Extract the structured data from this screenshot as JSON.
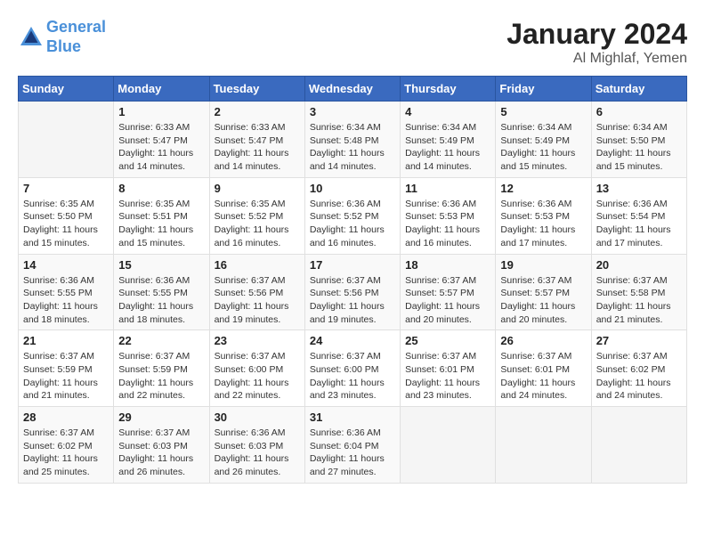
{
  "header": {
    "logo_line1": "General",
    "logo_line2": "Blue",
    "main_title": "January 2024",
    "subtitle": "Al Mighlaf, Yemen"
  },
  "days_of_week": [
    "Sunday",
    "Monday",
    "Tuesday",
    "Wednesday",
    "Thursday",
    "Friday",
    "Saturday"
  ],
  "weeks": [
    [
      {
        "day": "",
        "sunrise": "",
        "sunset": "",
        "daylight": "",
        "empty": true
      },
      {
        "day": "1",
        "sunrise": "Sunrise: 6:33 AM",
        "sunset": "Sunset: 5:47 PM",
        "daylight": "Daylight: 11 hours and 14 minutes."
      },
      {
        "day": "2",
        "sunrise": "Sunrise: 6:33 AM",
        "sunset": "Sunset: 5:47 PM",
        "daylight": "Daylight: 11 hours and 14 minutes."
      },
      {
        "day": "3",
        "sunrise": "Sunrise: 6:34 AM",
        "sunset": "Sunset: 5:48 PM",
        "daylight": "Daylight: 11 hours and 14 minutes."
      },
      {
        "day": "4",
        "sunrise": "Sunrise: 6:34 AM",
        "sunset": "Sunset: 5:49 PM",
        "daylight": "Daylight: 11 hours and 14 minutes."
      },
      {
        "day": "5",
        "sunrise": "Sunrise: 6:34 AM",
        "sunset": "Sunset: 5:49 PM",
        "daylight": "Daylight: 11 hours and 15 minutes."
      },
      {
        "day": "6",
        "sunrise": "Sunrise: 6:34 AM",
        "sunset": "Sunset: 5:50 PM",
        "daylight": "Daylight: 11 hours and 15 minutes."
      }
    ],
    [
      {
        "day": "7",
        "sunrise": "Sunrise: 6:35 AM",
        "sunset": "Sunset: 5:50 PM",
        "daylight": "Daylight: 11 hours and 15 minutes."
      },
      {
        "day": "8",
        "sunrise": "Sunrise: 6:35 AM",
        "sunset": "Sunset: 5:51 PM",
        "daylight": "Daylight: 11 hours and 15 minutes."
      },
      {
        "day": "9",
        "sunrise": "Sunrise: 6:35 AM",
        "sunset": "Sunset: 5:52 PM",
        "daylight": "Daylight: 11 hours and 16 minutes."
      },
      {
        "day": "10",
        "sunrise": "Sunrise: 6:36 AM",
        "sunset": "Sunset: 5:52 PM",
        "daylight": "Daylight: 11 hours and 16 minutes."
      },
      {
        "day": "11",
        "sunrise": "Sunrise: 6:36 AM",
        "sunset": "Sunset: 5:53 PM",
        "daylight": "Daylight: 11 hours and 16 minutes."
      },
      {
        "day": "12",
        "sunrise": "Sunrise: 6:36 AM",
        "sunset": "Sunset: 5:53 PM",
        "daylight": "Daylight: 11 hours and 17 minutes."
      },
      {
        "day": "13",
        "sunrise": "Sunrise: 6:36 AM",
        "sunset": "Sunset: 5:54 PM",
        "daylight": "Daylight: 11 hours and 17 minutes."
      }
    ],
    [
      {
        "day": "14",
        "sunrise": "Sunrise: 6:36 AM",
        "sunset": "Sunset: 5:55 PM",
        "daylight": "Daylight: 11 hours and 18 minutes."
      },
      {
        "day": "15",
        "sunrise": "Sunrise: 6:36 AM",
        "sunset": "Sunset: 5:55 PM",
        "daylight": "Daylight: 11 hours and 18 minutes."
      },
      {
        "day": "16",
        "sunrise": "Sunrise: 6:37 AM",
        "sunset": "Sunset: 5:56 PM",
        "daylight": "Daylight: 11 hours and 19 minutes."
      },
      {
        "day": "17",
        "sunrise": "Sunrise: 6:37 AM",
        "sunset": "Sunset: 5:56 PM",
        "daylight": "Daylight: 11 hours and 19 minutes."
      },
      {
        "day": "18",
        "sunrise": "Sunrise: 6:37 AM",
        "sunset": "Sunset: 5:57 PM",
        "daylight": "Daylight: 11 hours and 20 minutes."
      },
      {
        "day": "19",
        "sunrise": "Sunrise: 6:37 AM",
        "sunset": "Sunset: 5:57 PM",
        "daylight": "Daylight: 11 hours and 20 minutes."
      },
      {
        "day": "20",
        "sunrise": "Sunrise: 6:37 AM",
        "sunset": "Sunset: 5:58 PM",
        "daylight": "Daylight: 11 hours and 21 minutes."
      }
    ],
    [
      {
        "day": "21",
        "sunrise": "Sunrise: 6:37 AM",
        "sunset": "Sunset: 5:59 PM",
        "daylight": "Daylight: 11 hours and 21 minutes."
      },
      {
        "day": "22",
        "sunrise": "Sunrise: 6:37 AM",
        "sunset": "Sunset: 5:59 PM",
        "daylight": "Daylight: 11 hours and 22 minutes."
      },
      {
        "day": "23",
        "sunrise": "Sunrise: 6:37 AM",
        "sunset": "Sunset: 6:00 PM",
        "daylight": "Daylight: 11 hours and 22 minutes."
      },
      {
        "day": "24",
        "sunrise": "Sunrise: 6:37 AM",
        "sunset": "Sunset: 6:00 PM",
        "daylight": "Daylight: 11 hours and 23 minutes."
      },
      {
        "day": "25",
        "sunrise": "Sunrise: 6:37 AM",
        "sunset": "Sunset: 6:01 PM",
        "daylight": "Daylight: 11 hours and 23 minutes."
      },
      {
        "day": "26",
        "sunrise": "Sunrise: 6:37 AM",
        "sunset": "Sunset: 6:01 PM",
        "daylight": "Daylight: 11 hours and 24 minutes."
      },
      {
        "day": "27",
        "sunrise": "Sunrise: 6:37 AM",
        "sunset": "Sunset: 6:02 PM",
        "daylight": "Daylight: 11 hours and 24 minutes."
      }
    ],
    [
      {
        "day": "28",
        "sunrise": "Sunrise: 6:37 AM",
        "sunset": "Sunset: 6:02 PM",
        "daylight": "Daylight: 11 hours and 25 minutes."
      },
      {
        "day": "29",
        "sunrise": "Sunrise: 6:37 AM",
        "sunset": "Sunset: 6:03 PM",
        "daylight": "Daylight: 11 hours and 26 minutes."
      },
      {
        "day": "30",
        "sunrise": "Sunrise: 6:36 AM",
        "sunset": "Sunset: 6:03 PM",
        "daylight": "Daylight: 11 hours and 26 minutes."
      },
      {
        "day": "31",
        "sunrise": "Sunrise: 6:36 AM",
        "sunset": "Sunset: 6:04 PM",
        "daylight": "Daylight: 11 hours and 27 minutes."
      },
      {
        "day": "",
        "sunrise": "",
        "sunset": "",
        "daylight": "",
        "empty": true
      },
      {
        "day": "",
        "sunrise": "",
        "sunset": "",
        "daylight": "",
        "empty": true
      },
      {
        "day": "",
        "sunrise": "",
        "sunset": "",
        "daylight": "",
        "empty": true
      }
    ]
  ]
}
